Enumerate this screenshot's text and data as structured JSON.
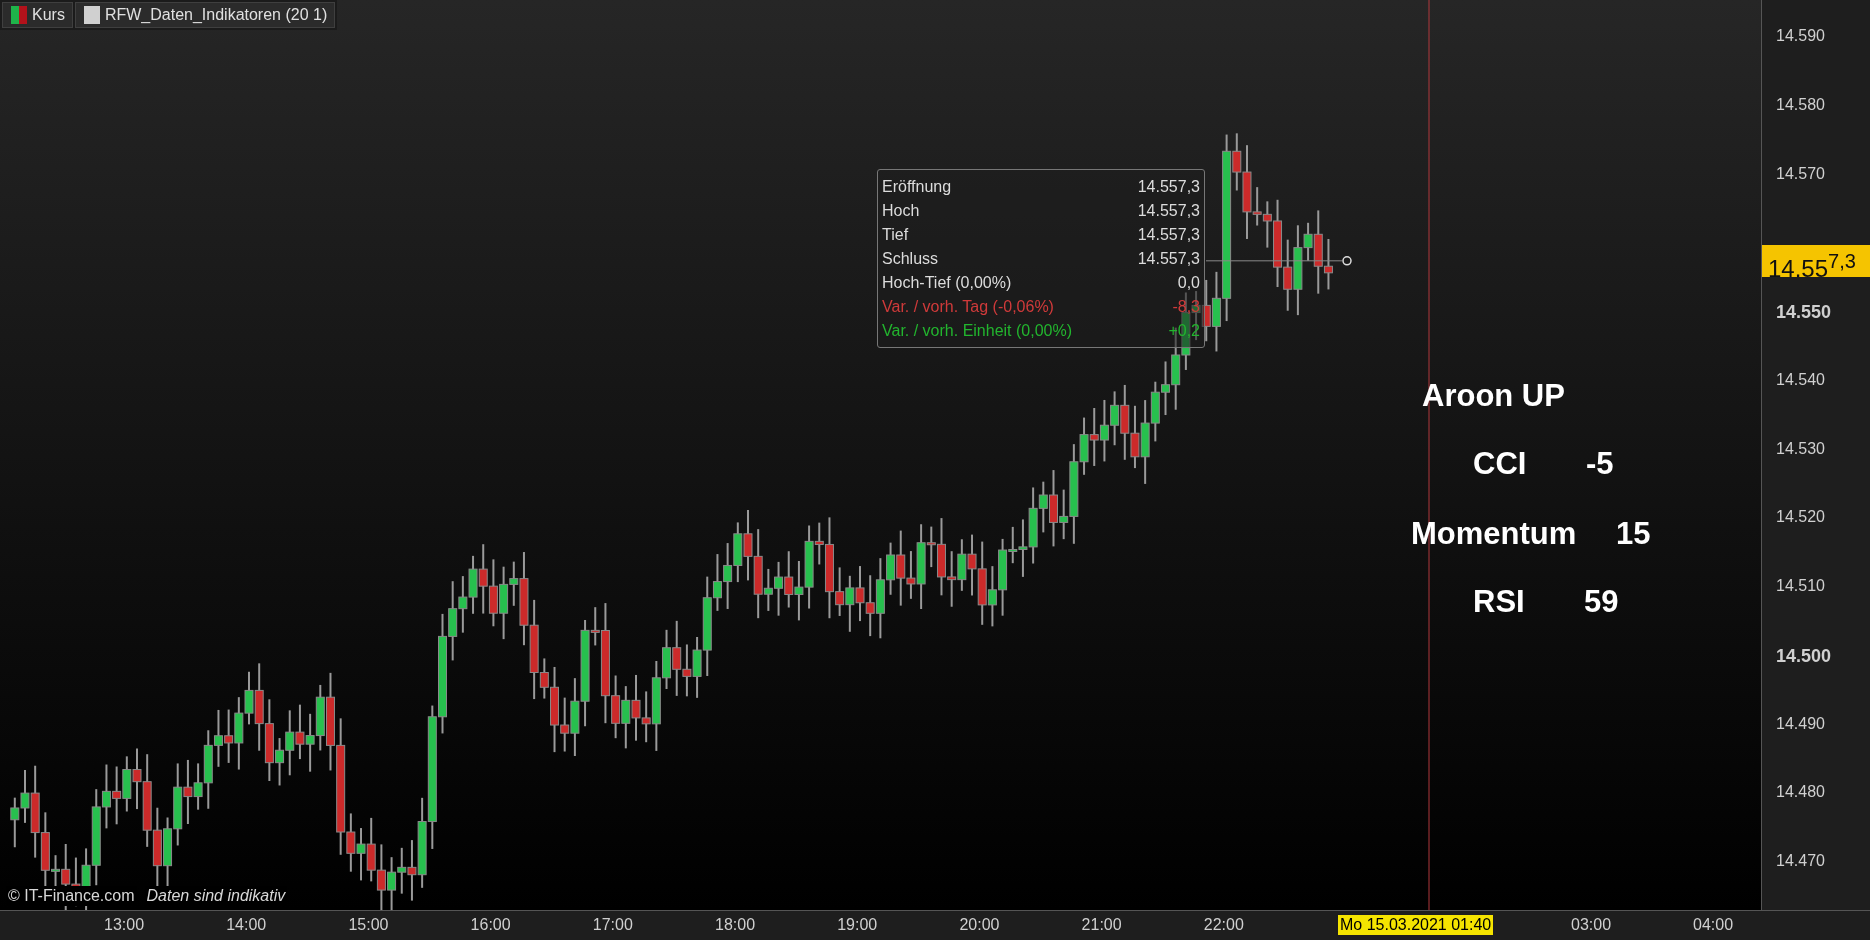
{
  "legend": [
    {
      "label": "Kurs",
      "kind": "candles"
    },
    {
      "label": "RFW_Daten_Indikatoren (20 1)",
      "kind": "indicator"
    }
  ],
  "tooltip": {
    "rows": [
      {
        "label": "Eröffnung",
        "value": "14.557,3",
        "color": "#dcdcdc"
      },
      {
        "label": "Hoch",
        "value": "14.557,3",
        "color": "#dcdcdc"
      },
      {
        "label": "Tief",
        "value": "14.557,3",
        "color": "#dcdcdc"
      },
      {
        "label": "Schluss",
        "value": "14.557,3",
        "color": "#dcdcdc"
      },
      {
        "label": "Hoch-Tief (0,00%)",
        "value": "0,0",
        "color": "#dcdcdc"
      },
      {
        "label": "Var. / vorh. Tag (-0,06%)",
        "value": "-8,3",
        "color": "#d03a3a"
      },
      {
        "label": "Var. / vorh. Einheit (0,00%)",
        "value": "+0,2",
        "color": "#22b52e"
      }
    ]
  },
  "indicators": [
    {
      "label": "Aroon UP"
    },
    {
      "label": "CCI",
      "value": "-5"
    },
    {
      "label": "Momentum",
      "value": "15"
    },
    {
      "label": "RSI",
      "value": "59"
    }
  ],
  "price_axis": {
    "ticks": [
      {
        "label": "14.590",
        "bold": false
      },
      {
        "label": "14.580",
        "bold": false
      },
      {
        "label": "14.570",
        "bold": false
      },
      {
        "label": "14.550",
        "bold": true
      },
      {
        "label": "14.540",
        "bold": false
      },
      {
        "label": "14.530",
        "bold": false
      },
      {
        "label": "14.520",
        "bold": false
      },
      {
        "label": "14.510",
        "bold": false
      },
      {
        "label": "14.500",
        "bold": true
      },
      {
        "label": "14.490",
        "bold": false
      },
      {
        "label": "14.480",
        "bold": false
      },
      {
        "label": "14.470",
        "bold": false
      }
    ],
    "current_price": "14.55$^{7,3}$"
  },
  "time_axis": {
    "ticks": [
      "13:00",
      "14:00",
      "15:00",
      "16:00",
      "17:00",
      "18:00",
      "19:00",
      "20:00",
      "21:00",
      "22:00",
      "03:00",
      "04:00"
    ],
    "cursor_label": "Mo 15.03.2021 01:40"
  },
  "credit": {
    "copyright": "© IT-Finance.com",
    "note": "Daten sind indikativ"
  }
}
